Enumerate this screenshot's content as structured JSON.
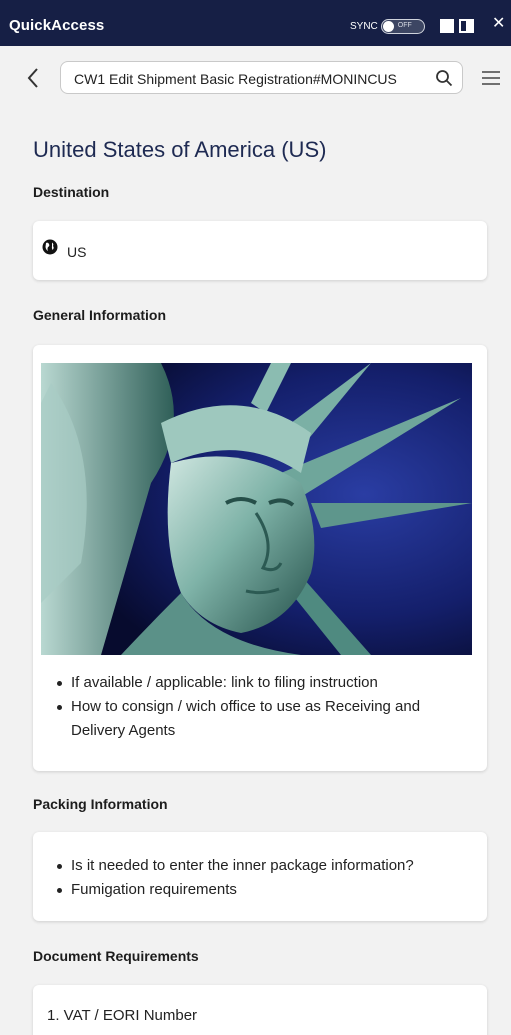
{
  "app": {
    "title": "QuickAccess",
    "sync_label": "SYNC",
    "sync_state": "OFF"
  },
  "search": {
    "value": "CW1 Edit Shipment Basic Registration#MONINCUS"
  },
  "page": {
    "country_title": "United States of America (US)"
  },
  "destination": {
    "heading": "Destination",
    "value": "US"
  },
  "general": {
    "heading": "General Information",
    "bullets": [
      "If available / applicable: link to filing instruction",
      "How to consign / wich office to use as Receiving and",
      "Delivery Agents"
    ]
  },
  "packing": {
    "heading": "Packing Information",
    "bullets": [
      "Is it needed to enter the inner package information?",
      "Fumigation requirements"
    ]
  },
  "documents": {
    "heading": "Document Requirements",
    "items": [
      "1. VAT / EORI Number"
    ]
  },
  "colors": {
    "titlebar": "#161f45",
    "accent_title": "#1e2a52",
    "page_bg": "#f2f2f2"
  },
  "icons": [
    "back-icon",
    "search-icon",
    "menu-icon",
    "globe-icon",
    "close-icon"
  ]
}
